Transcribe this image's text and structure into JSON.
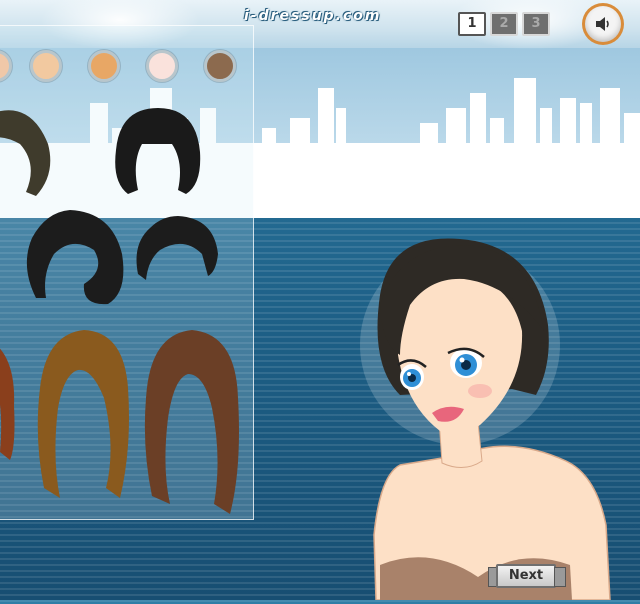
{
  "header": {
    "logo_text": "i-dressup.com",
    "pages": [
      "1",
      "2",
      "3"
    ],
    "active_page": "1"
  },
  "icons": {
    "sound": "speaker-icon"
  },
  "palette": {
    "hair_color_swatches": [
      "#f2c9a0",
      "#e8a765",
      "#fae2dc",
      "#8c6a4e"
    ]
  },
  "model": {
    "hair_color": "#2e2a25",
    "skin_color": "#fde0c6",
    "eye_color": "#2f8fd6",
    "lip_color": "#e8667c"
  },
  "footer": {
    "next_label": "Next"
  }
}
